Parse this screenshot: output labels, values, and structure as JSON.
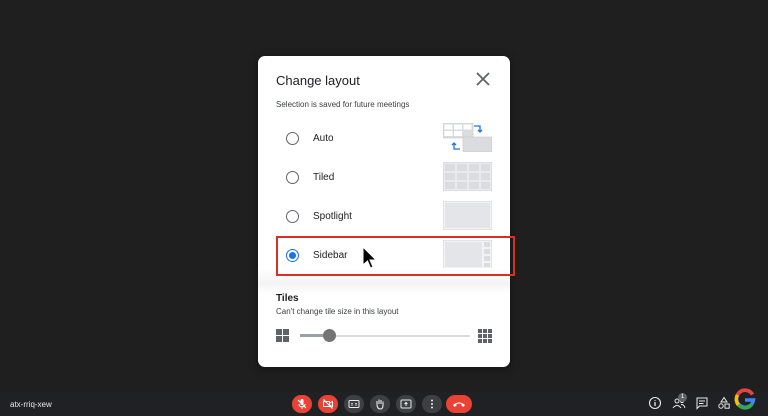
{
  "dialog": {
    "title": "Change layout",
    "subtitle": "Selection is saved for future meetings",
    "options": [
      {
        "label": "Auto",
        "selected": false,
        "thumb": "auto-layout-icon"
      },
      {
        "label": "Tiled",
        "selected": false,
        "thumb": "tiled-layout-icon"
      },
      {
        "label": "Spotlight",
        "selected": false,
        "thumb": "spotlight-layout-icon"
      },
      {
        "label": "Sidebar",
        "selected": true,
        "thumb": "sidebar-layout-icon"
      }
    ],
    "tiles": {
      "title": "Tiles",
      "subtitle": "Can't change tile size in this layout",
      "slider_fraction": 0.18
    }
  },
  "bottombar": {
    "meeting_code": "atx-rriq-xew",
    "people_count": "1"
  },
  "colors": {
    "accent": "#1a73e8",
    "highlight_border": "#d93025",
    "end_call": "#ea4335",
    "background": "#1f1f1f"
  }
}
